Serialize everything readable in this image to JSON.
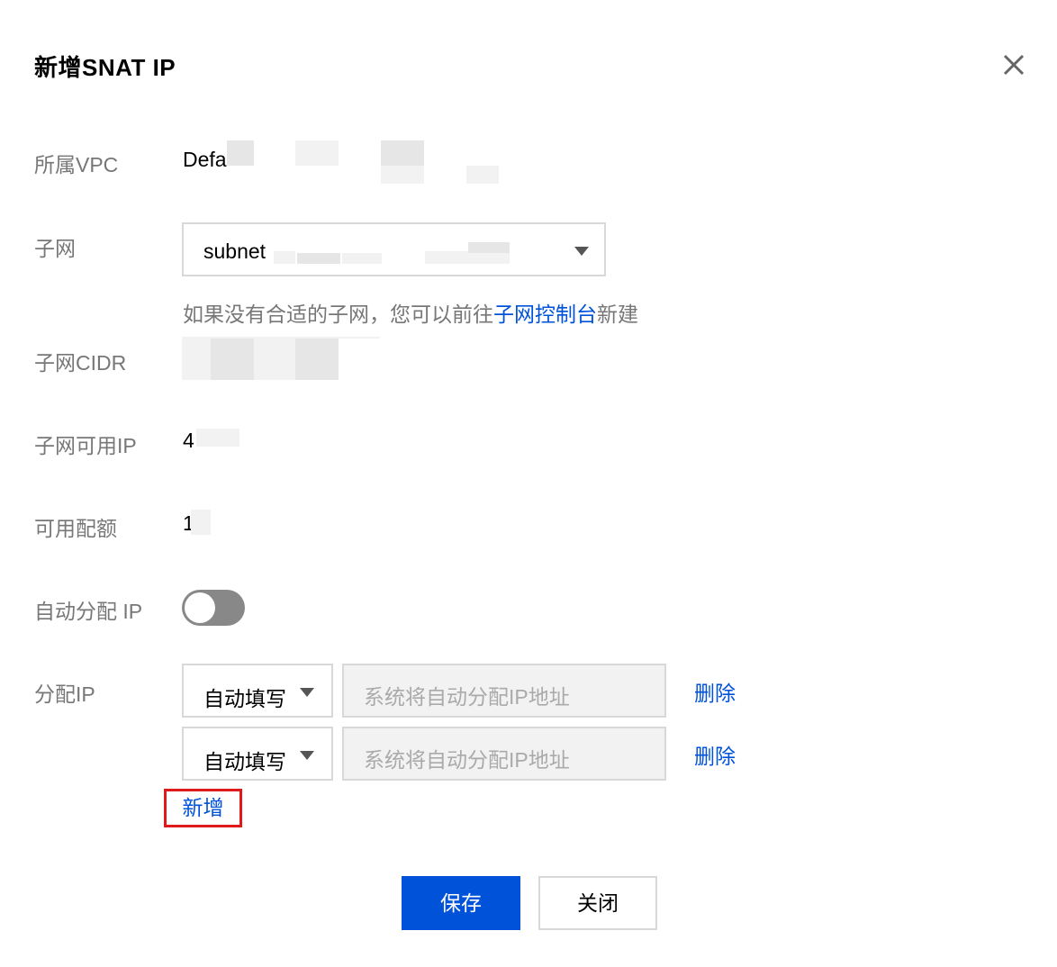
{
  "dialog": {
    "title": "新增SNAT IP",
    "close_icon": "close-icon"
  },
  "form": {
    "vpc": {
      "label": "所属VPC",
      "value": "Defa"
    },
    "subnet": {
      "label": "子网",
      "selected": "subnet",
      "hint_before": "如果没有合适的子网，您可以前往",
      "hint_link": "子网控制台",
      "hint_after": "新建"
    },
    "subnet_cidr": {
      "label": "子网CIDR",
      "value": ""
    },
    "subnet_available_ip": {
      "label": "子网可用IP",
      "value": "4"
    },
    "available_quota": {
      "label": "可用配额",
      "value": "1"
    },
    "auto_assign": {
      "label": "自动分配 IP",
      "enabled": false
    },
    "assign_ip": {
      "label": "分配IP",
      "rows": [
        {
          "mode": "自动填写",
          "placeholder": "系统将自动分配IP地址",
          "delete_label": "删除"
        },
        {
          "mode": "自动填写",
          "placeholder": "系统将自动分配IP地址",
          "delete_label": "删除"
        }
      ],
      "add_label": "新增"
    }
  },
  "footer": {
    "save_label": "保存",
    "close_label": "关闭"
  },
  "colors": {
    "accent": "#0052d9",
    "highlight_border": "#e01a1a",
    "toggle_off": "#888888"
  }
}
